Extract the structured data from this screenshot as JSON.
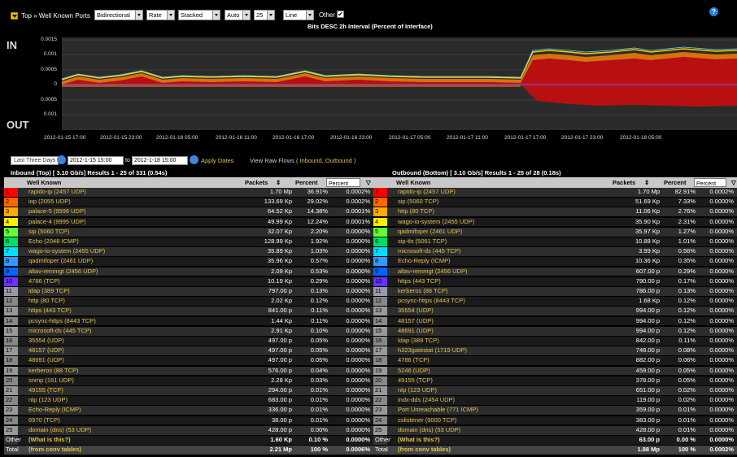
{
  "header": {
    "breadcrumb": "Top » Well Known Ports",
    "selects": [
      "Bidirectional",
      "Rate",
      "Stacked",
      "Auto",
      "25",
      "Line"
    ],
    "other_label": "Other",
    "other_checked": "✔",
    "subtitle": "Bits DESC  2h Interval (Percent of Interface)"
  },
  "chart": {
    "in_label": "IN",
    "out_label": "OUT",
    "y_ticks": [
      "0.0015",
      "0.001",
      "0.0005",
      "0",
      "0.0005",
      "0.001"
    ],
    "x_ticks": [
      "2012-01-15 17:00",
      "2012-01-15 23:00",
      "2012-01-16 05:00",
      "2012-01-16 11:00",
      "2012-01-16 17:00",
      "2012-01-16 23:00",
      "2012-01-17 05:00",
      "2012-01-17 11:00",
      "2012-01-17 17:00",
      "2012-01-17 23:00",
      "2012-01-18 05:00"
    ]
  },
  "datebar": {
    "preset": "Last Three Days",
    "from": "2012-1-15 15:00",
    "to_label": "to",
    "to": "2012-1-18 15:00",
    "apply": "Apply Dates",
    "raw_flows": "View Raw Flows (",
    "inbound": "Inbound",
    "sep": ",",
    "outbound": "Outbound",
    "close": ")"
  },
  "inbound": {
    "title": "Inbound (Top) [ 3.10 Gb/s] Results 1 - 25 of 331 (0.54s)",
    "col_name": "Well Known",
    "col_packets": "Packets",
    "col_percent": "Percent",
    "col_sel": "Percent",
    "rows": [
      [
        "1",
        "rapido-ip (2457 UDP)",
        "1.70 Mp",
        "36.91%",
        "0.0002%"
      ],
      [
        "2",
        "iop (2055 UDP)",
        "133.69 Kp",
        "29.02%",
        "0.0002%"
      ],
      [
        "3",
        "palace-5 (9996 UDP)",
        "64.52 Kp",
        "14.38%",
        "0.0001%"
      ],
      [
        "4",
        "palace-4 (9995 UDP)",
        "49.99 Kp",
        "12.24%",
        "0.0001%"
      ],
      [
        "5",
        "sip (5060 TCP)",
        "32.07 Kp",
        "2.20%",
        "0.0000%"
      ],
      [
        "6",
        "Echo (2048 ICMP)",
        "128.99 Kp",
        "1.92%",
        "0.0000%"
      ],
      [
        "7",
        "wago-io-system (2455 UDP)",
        "35.89 Kp",
        "1.03%",
        "0.0000%"
      ],
      [
        "8",
        "qadmifoper (2461 UDP)",
        "35.96 Kp",
        "0.57%",
        "0.0000%"
      ],
      [
        "9",
        "altav-remmgt (2456 UDP)",
        "2.09 Kp",
        "0.53%",
        "0.0000%"
      ],
      [
        "10",
        "4786 (TCP)",
        "10.19 Kp",
        "0.29%",
        "0.0000%"
      ],
      [
        "11",
        "ldap (389 TCP)",
        "797.00 p",
        "0.13%",
        "0.0000%"
      ],
      [
        "12",
        "http (80 TCP)",
        "2.02 Kp",
        "0.12%",
        "0.0000%"
      ],
      [
        "13",
        "https (443 TCP)",
        "841.00 p",
        "0.11%",
        "0.0000%"
      ],
      [
        "14",
        "pcsync-https (8443 TCP)",
        "1.44 Kp",
        "0.11%",
        "0.0000%"
      ],
      [
        "15",
        "microsoft-ds (445 TCP)",
        "2.91 Kp",
        "0.10%",
        "0.0000%"
      ],
      [
        "16",
        "35554 (UDP)",
        "497.00 p",
        "0.05%",
        "0.0000%"
      ],
      [
        "17",
        "48157 (UDP)",
        "497.00 p",
        "0.05%",
        "0.0000%"
      ],
      [
        "18",
        "48691 (UDP)",
        "497.00 p",
        "0.05%",
        "0.0000%"
      ],
      [
        "19",
        "kerberos (88 TCP)",
        "576.00 p",
        "0.04%",
        "0.0000%"
      ],
      [
        "20",
        "snmp (161 UDP)",
        "2.28 Kp",
        "0.03%",
        "0.0000%"
      ],
      [
        "21",
        "49155 (TCP)",
        "294.00 p",
        "0.01%",
        "0.0000%"
      ],
      [
        "22",
        "ntp (123 UDP)",
        "683.00 p",
        "0.01%",
        "0.0000%"
      ],
      [
        "23",
        "Echo-Reply (ICMP)",
        "336.00 p",
        "0.01%",
        "0.0000%"
      ],
      [
        "24",
        "6970 (TCP)",
        "38.00 p",
        "0.01%",
        "0.0000%"
      ],
      [
        "25",
        "domain (dns) (53 UDP)",
        "428.00 p",
        "0.00%",
        "0.0000%"
      ]
    ],
    "other": [
      "Other",
      "(What is this?)",
      "1.60 Kp",
      "0.10 %",
      "0.0000%"
    ],
    "total": [
      "Total",
      "(from conv tables)",
      "2.21 Mp",
      "100 %",
      "0.0006%"
    ]
  },
  "outbound": {
    "title": "Outbound (Bottom) [ 3.10 Gb/s] Results 1 - 25 of 28 (0.18s)",
    "col_name": "Well Known",
    "col_packets": "Packets",
    "col_percent": "Percent",
    "col_sel": "Percent",
    "rows": [
      [
        "1",
        "rapido-ip (2457 UDP)",
        "1.70 Mp",
        "82.91%",
        "0.0002%"
      ],
      [
        "2",
        "sip (5060 TCP)",
        "51.69 Kp",
        "7.33%",
        "0.0000%"
      ],
      [
        "3",
        "http (80 TCP)",
        "11.06 Kp",
        "2.76%",
        "0.0000%"
      ],
      [
        "4",
        "wago-io-system (2455 UDP)",
        "35.90 Kp",
        "2.31%",
        "0.0000%"
      ],
      [
        "5",
        "qadmifoper (2461 UDP)",
        "35.97 Kp",
        "1.27%",
        "0.0000%"
      ],
      [
        "6",
        "sip-tls (5061 TCP)",
        "10.88 Kp",
        "1.01%",
        "0.0000%"
      ],
      [
        "7",
        "microsoft-ds (445 TCP)",
        "3.99 Kp",
        "0.56%",
        "0.0000%"
      ],
      [
        "8",
        "Echo-Reply (ICMP)",
        "10.36 Kp",
        "0.35%",
        "0.0000%"
      ],
      [
        "9",
        "altav-remmgt (2456 UDP)",
        "607.00 p",
        "0.29%",
        "0.0000%"
      ],
      [
        "10",
        "https (443 TCP)",
        "790.00 p",
        "0.17%",
        "0.0000%"
      ],
      [
        "11",
        "kerberos (88 TCP)",
        "786.00 p",
        "0.13%",
        "0.0000%"
      ],
      [
        "12",
        "pcsync-https (8443 TCP)",
        "1.68 Kp",
        "0.12%",
        "0.0000%"
      ],
      [
        "13",
        "35554 (UDP)",
        "994.00 p",
        "0.12%",
        "0.0000%"
      ],
      [
        "14",
        "48157 (UDP)",
        "994.00 p",
        "0.12%",
        "0.0000%"
      ],
      [
        "15",
        "48691 (UDP)",
        "994.00 p",
        "0.12%",
        "0.0000%"
      ],
      [
        "16",
        "ldap (389 TCP)",
        "842.00 p",
        "0.11%",
        "0.0000%"
      ],
      [
        "17",
        "h323gatestat (1719 UDP)",
        "748.00 p",
        "0.08%",
        "0.0000%"
      ],
      [
        "18",
        "4786 (TCP)",
        "882.00 p",
        "0.06%",
        "0.0000%"
      ],
      [
        "19",
        "5246 (UDP)",
        "459.00 p",
        "0.05%",
        "0.0000%"
      ],
      [
        "20",
        "49155 (TCP)",
        "378.00 p",
        "0.05%",
        "0.0000%"
      ],
      [
        "21",
        "ntp (123 UDP)",
        "651.00 p",
        "0.02%",
        "0.0000%"
      ],
      [
        "22",
        "indx-dds (2454 UDP)",
        "119.00 p",
        "0.02%",
        "0.0000%"
      ],
      [
        "23",
        "Port Unreachable (771 ICMP)",
        "359.00 p",
        "0.01%",
        "0.0000%"
      ],
      [
        "24",
        "cslistener (9000 TCP)",
        "383.00 p",
        "0.01%",
        "0.0000%"
      ],
      [
        "25",
        "domain (dns) (53 UDP)",
        "428.00 p",
        "0.01%",
        "0.0000%"
      ]
    ],
    "other": [
      "Other",
      "(What is this?)",
      "63.00 p",
      "0.00 %",
      "0.0000%"
    ],
    "total": [
      "Total",
      "(from conv tables)",
      "1.88 Mp",
      "100 %",
      "0.0002%"
    ]
  },
  "rank_colors": [
    "#ff0000",
    "#ff6600",
    "#ffaa00",
    "#ffee00",
    "#66ff33",
    "#00dd66",
    "#00ddff",
    "#3399ff",
    "#0066ff",
    "#6633ff",
    "#9999aa",
    "#888888",
    "#999999",
    "#888888",
    "#999999",
    "#888888",
    "#999999",
    "#888888",
    "#999999",
    "#888888",
    "#999999",
    "#888888",
    "#999999",
    "#888888",
    "#999999"
  ]
}
